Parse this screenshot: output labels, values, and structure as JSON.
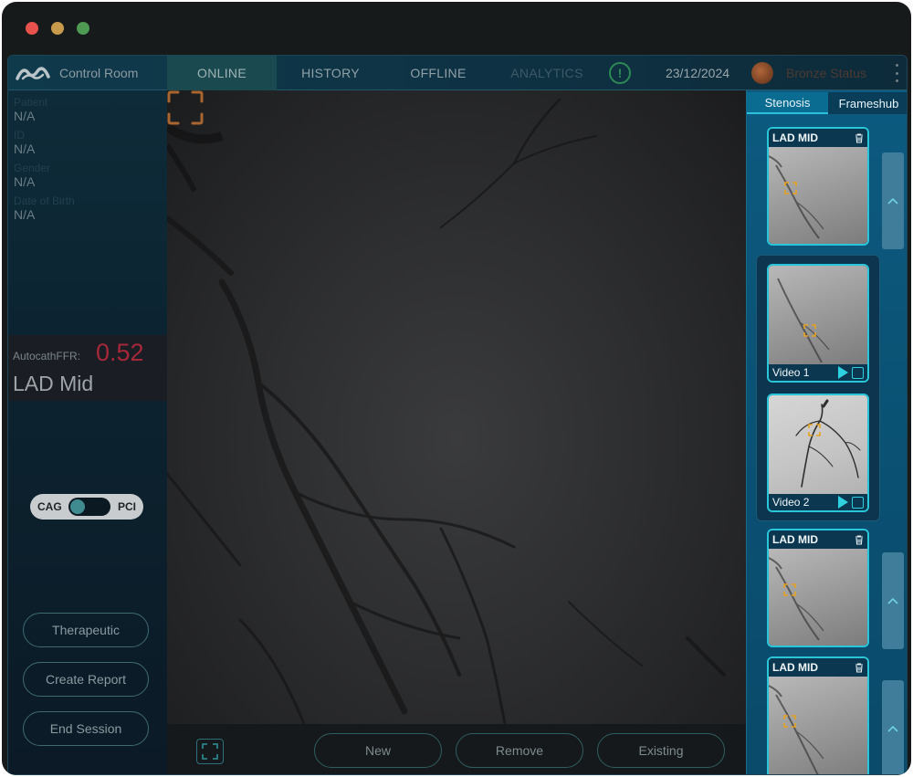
{
  "app": {
    "name": "Control Room",
    "logo_icon": "brand-logo-icon"
  },
  "nav": {
    "tabs": [
      "ONLINE",
      "HISTORY",
      "OFFLINE",
      "ANALYTICS"
    ],
    "active_tab": "ONLINE",
    "disabled_tab": "ANALYTICS",
    "date": "23/12/2024",
    "status": "Bronze Status",
    "alert_symbol": "!"
  },
  "patient": {
    "fields": [
      {
        "label": "Patient",
        "value": "N/A"
      },
      {
        "label": "ID",
        "value": "N/A"
      },
      {
        "label": "Gender",
        "value": "N/A"
      },
      {
        "label": "Date of Birth",
        "value": "N/A"
      }
    ]
  },
  "ffr": {
    "label": "AutocathFFR:",
    "value": "0.52",
    "segment": "LAD Mid",
    "value_color": "#a5283a"
  },
  "mode_toggle": {
    "left": "CAG",
    "right": "PCI",
    "selected": "CAG"
  },
  "side_buttons": [
    "Therapeutic",
    "Create Report",
    "End Session"
  ],
  "bottom_buttons": [
    "New",
    "Remove",
    "Existing"
  ],
  "right_panel": {
    "tabs": [
      "Stenosis",
      "Frameshub"
    ],
    "active_tab": "Stenosis",
    "cards": [
      {
        "title": "LAD MID",
        "icon": "trash-icon"
      },
      {
        "video": "Video 1"
      },
      {
        "video": "Video 2"
      },
      {
        "title": "LAD MID",
        "icon": "trash-icon"
      },
      {
        "title": "LAD MID",
        "icon": "trash-icon"
      }
    ]
  },
  "colors": {
    "accent": "#28c6d8",
    "focus_bracket": "#b06a32",
    "marker": "#e8a21c"
  }
}
